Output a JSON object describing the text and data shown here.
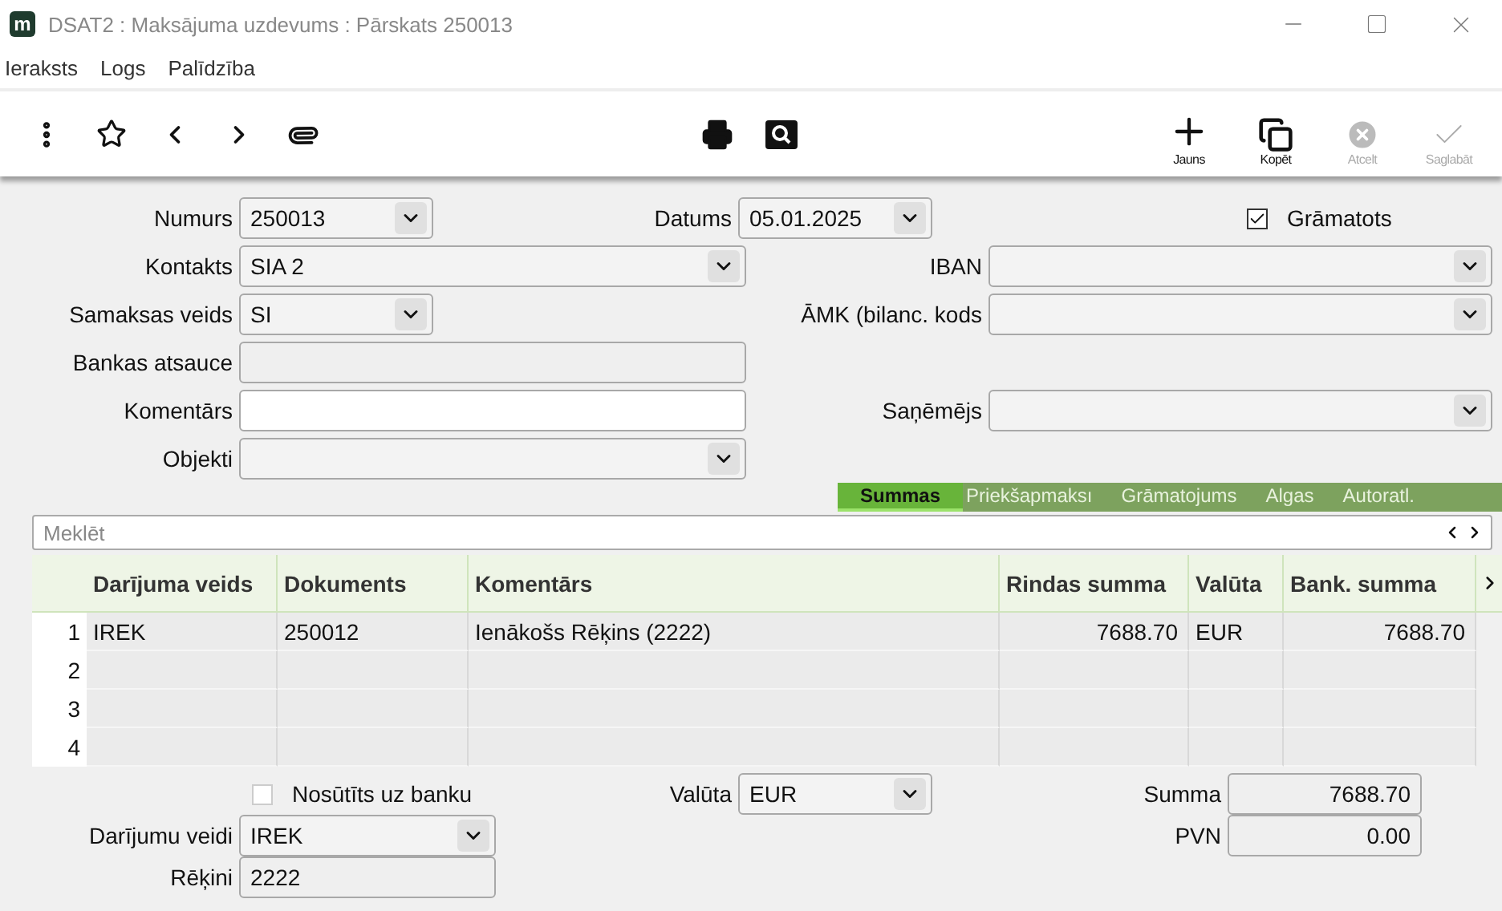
{
  "window": {
    "logo": "m",
    "title": "DSAT2 : Maksājuma uzdevums : Pārskats 250013"
  },
  "menu": [
    "Ieraksts",
    "Logs",
    "Palīdzība"
  ],
  "toolbar_actions": [
    {
      "kind": "new",
      "label": "Jauns",
      "disabled": false
    },
    {
      "kind": "copy",
      "label": "Kopēt",
      "disabled": false
    },
    {
      "kind": "cancel",
      "label": "Atcelt",
      "disabled": true
    },
    {
      "kind": "save",
      "label": "Saglabāt",
      "disabled": true
    }
  ],
  "form": {
    "numurs": {
      "label": "Numurs",
      "value": "250013"
    },
    "datums": {
      "label": "Datums",
      "value": "05.01.2025"
    },
    "gramatots": {
      "label": "Grāmatots",
      "checked": true
    },
    "kontakts": {
      "label": "Kontakts",
      "value": "SIA 2"
    },
    "iban": {
      "label": "IBAN"
    },
    "samaksas_veids": {
      "label": "Samaksas veids",
      "value": "SI"
    },
    "amk": {
      "label": "ĀMK (bilanc. kods"
    },
    "bankas_atsauce": {
      "label": "Bankas atsauce",
      "disabled": true
    },
    "komentars": {
      "label": "Komentārs",
      "disabled": false
    },
    "sanemejs": {
      "label": "Saņēmējs"
    },
    "objekti": {
      "label": "Objekti"
    }
  },
  "tabs": [
    {
      "label": "Summas",
      "selected": true
    },
    {
      "label": "Priekšapmaksı",
      "selected": false
    },
    {
      "label": "Grāmatojums",
      "selected": false
    },
    {
      "label": "Algas",
      "selected": false
    },
    {
      "label": "Autoratl.",
      "selected": false
    }
  ],
  "search": {
    "placeholder": "Meklēt"
  },
  "table": {
    "columns": [
      "Darījuma veids",
      "Dokuments",
      "Komentārs",
      "Rindas summa",
      "Valūta",
      "Bank. summa"
    ],
    "rows": [
      {
        "number": "1",
        "cells": [
          "IREK",
          "250012",
          "Ienākošs Rēķins (2222)",
          "7688.70",
          "EUR",
          "7688.70"
        ]
      },
      {
        "number": "2"
      },
      {
        "number": "3"
      },
      {
        "number": "4"
      }
    ]
  },
  "footer": {
    "nosutits": {
      "label": "Nosūtīts uz banku",
      "checked": false
    },
    "valuta": {
      "label": "Valūta",
      "value": "EUR"
    },
    "summa": {
      "label": "Summa",
      "value": "7688.70",
      "disabled": true
    },
    "darijumu_veidi": {
      "label": "Darījumu veidi",
      "value": "IREK"
    },
    "pvn": {
      "label": "PVN",
      "value": "0.00",
      "disabled": true
    },
    "rekini": {
      "label": "Rēķini",
      "value": "2222",
      "disabled": true
    }
  }
}
